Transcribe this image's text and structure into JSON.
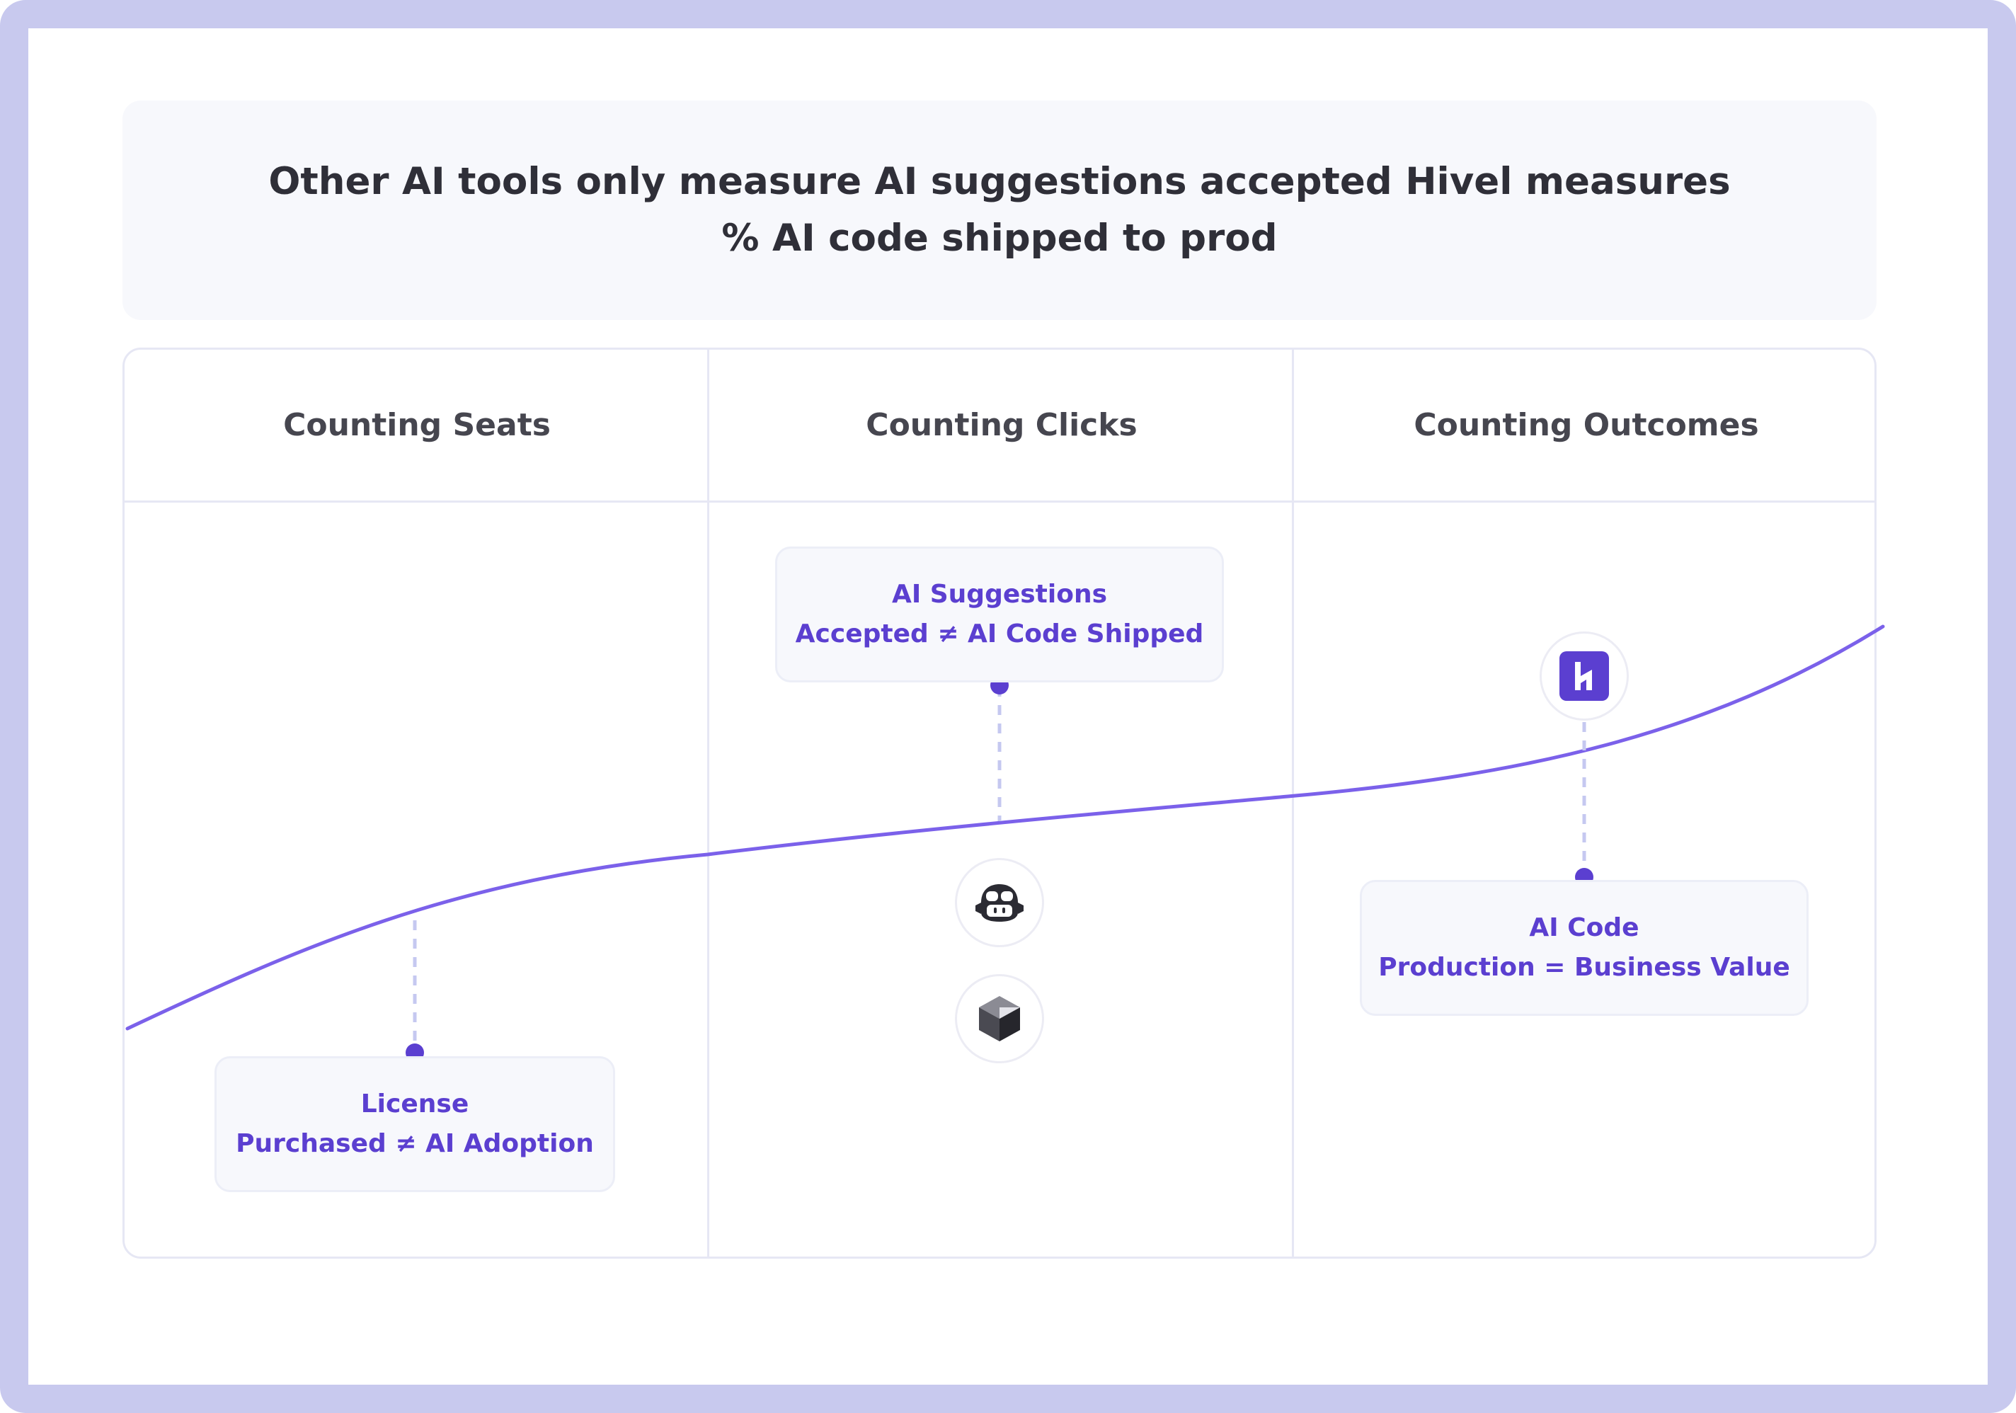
{
  "header": {
    "title_line1": "Other AI tools only measure AI suggestions accepted Hivel measures",
    "title_line2": "% AI code shipped to prod"
  },
  "columns": [
    {
      "title": "Counting Seats"
    },
    {
      "title": "Counting Clicks"
    },
    {
      "title": "Counting Outcomes"
    }
  ],
  "cards": {
    "seats": {
      "line1": "License",
      "line2": "Purchased ≠ AI Adoption"
    },
    "clicks": {
      "line1": "AI Suggestions",
      "line2": "Accepted ≠ AI Code Shipped"
    },
    "outcomes": {
      "line1": "AI Code",
      "line2": "Production = Business Value"
    }
  },
  "icons": [
    "copilot-icon",
    "cursor-icon",
    "hivel-logo-icon"
  ],
  "colors": {
    "frame": "#c8c9ee",
    "accent": "#5b3fd0",
    "curve": "#7b61ea",
    "connector": "#c5c8f0"
  }
}
